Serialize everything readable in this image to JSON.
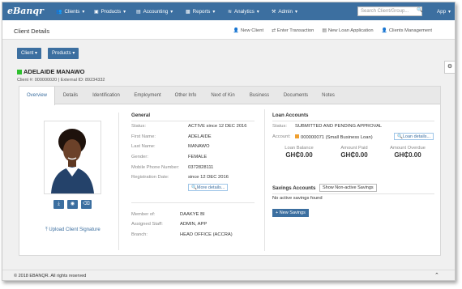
{
  "app": {
    "logo": "eBanqr"
  },
  "nav": {
    "clients": "Clients",
    "products": "Products",
    "accounting": "Accounting",
    "reports": "Reports",
    "analytics": "Analytics",
    "admin": "Admin",
    "app": "App"
  },
  "search": {
    "placeholder": "Search Client/Group..."
  },
  "header": {
    "title": "Client Details",
    "new_client": "New Client",
    "enter_transaction": "Enter Transaction",
    "new_loan_application": "New Loan Application",
    "clients_management": "Clients Management"
  },
  "actions": {
    "client": "Client",
    "products": "Products"
  },
  "client": {
    "name": "ADELAIDE MANAWO",
    "sub": "Client #: 000000020 | External ID: 89234332",
    "status_color": "#2ec02e"
  },
  "tabs": [
    "Overview",
    "Details",
    "Identification",
    "Employment",
    "Other Info",
    "Next of Kin",
    "Business",
    "Documents",
    "Notes"
  ],
  "general": {
    "title": "General",
    "status_label": "Status:",
    "status_value": "ACTIVE since 12 DEC 2016",
    "first_name_label": "First Name:",
    "first_name_value": "ADELAIDE",
    "last_name_label": "Last Name:",
    "last_name_value": "MANAWO",
    "gender_label": "Gender:",
    "gender_value": "FEMALE",
    "mobile_label": "Mobile Phone Number:",
    "mobile_value": "0372828111",
    "registration_label": "Registration Date:",
    "registration_value": "since 12 DEC 2016",
    "more_details": "More details..."
  },
  "membership": {
    "member_of_label": "Member of:",
    "member_of_value": "DAAKYE BI",
    "staff_label": "Assigned Staff:",
    "staff_value": "ADMIN, APP",
    "branch_label": "Branch:",
    "branch_value": "HEAD OFFICE (ACCRA)"
  },
  "photo": {
    "upload_signature": "Upload Client Signature"
  },
  "loans": {
    "title": "Loan Accounts",
    "status_label": "Status:",
    "status_value": "SUBMITTED AND PENDING APPROVAL",
    "account_label": "Account:",
    "account_value": "000000071 (Small Business Loan)",
    "loan_details": "Loan details...",
    "balance_label": "Loan Balance",
    "balance_value": "GH₵0.00",
    "paid_label": "Amount Paid",
    "paid_value": "GH₵0.00",
    "overdue_label": "Amount Overdue",
    "overdue_value": "GH₵0.00"
  },
  "savings": {
    "title": "Savings Accounts",
    "show_nonactive": "Show Non-active Savings",
    "none": "No active savings found",
    "new_savings": "+ New Savings"
  },
  "footer": {
    "copyright": "© 2018 EBANQR. All rights reserved"
  },
  "colors": {
    "primary": "#3c6fa0",
    "active_status": "#2ec02e",
    "pending_status": "#f0a030"
  }
}
